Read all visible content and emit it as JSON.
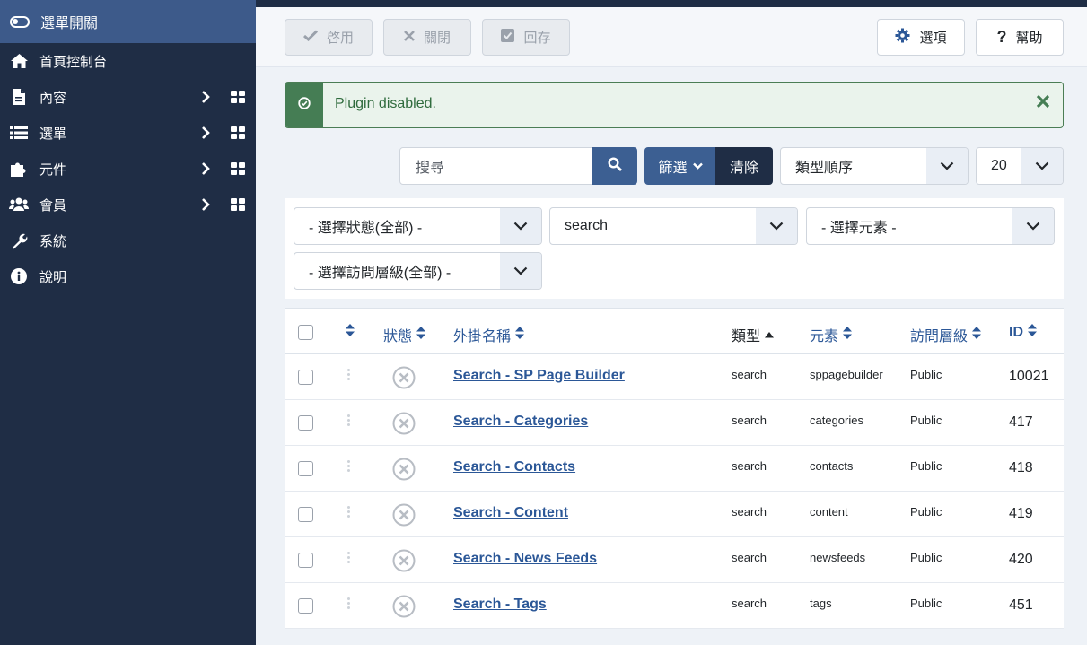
{
  "sidebar": {
    "toggle_label": "選單開關",
    "items": [
      {
        "label": "首頁控制台",
        "icon": "home-icon",
        "expandable": false
      },
      {
        "label": "內容",
        "icon": "file-icon",
        "expandable": true
      },
      {
        "label": "選單",
        "icon": "list-icon",
        "expandable": true
      },
      {
        "label": "元件",
        "icon": "puzzle-icon",
        "expandable": true
      },
      {
        "label": "會員",
        "icon": "users-icon",
        "expandable": true
      },
      {
        "label": "系統",
        "icon": "wrench-icon",
        "expandable": false
      },
      {
        "label": "說明",
        "icon": "info-icon",
        "expandable": false
      }
    ]
  },
  "toolbar": {
    "enable_label": "啓用",
    "disable_label": "關閉",
    "checkin_label": "回存",
    "options_label": "選項",
    "help_label": "幫助"
  },
  "alert": {
    "message": "Plugin disabled."
  },
  "search": {
    "placeholder": "搜尋",
    "filter_label": "篩選",
    "clear_label": "清除",
    "ordering_value": "類型順序",
    "limit_value": "20"
  },
  "filters": {
    "state": "- 選擇狀態(全部) -",
    "folder": "search",
    "element": "- 選擇元素 -",
    "access": "- 選擇訪問層級(全部) -"
  },
  "table": {
    "headers": {
      "status": "狀態",
      "name": "外掛名稱",
      "folder": "類型",
      "element": "元素",
      "access": "訪問層級",
      "id": "ID"
    },
    "rows": [
      {
        "name": "Search - SP Page Builder",
        "folder": "search",
        "element": "sppagebuilder",
        "access": "Public",
        "id": "10021"
      },
      {
        "name": "Search - Categories",
        "folder": "search",
        "element": "categories",
        "access": "Public",
        "id": "417"
      },
      {
        "name": "Search - Contacts",
        "folder": "search",
        "element": "contacts",
        "access": "Public",
        "id": "418"
      },
      {
        "name": "Search - Content",
        "folder": "search",
        "element": "content",
        "access": "Public",
        "id": "419"
      },
      {
        "name": "Search - News Feeds",
        "folder": "search",
        "element": "newsfeeds",
        "access": "Public",
        "id": "420"
      },
      {
        "name": "Search - Tags",
        "folder": "search",
        "element": "tags",
        "access": "Public",
        "id": "451"
      }
    ]
  },
  "colors": {
    "sidebar_bg": "#1f2d45",
    "sidebar_active": "#3d5a8a",
    "primary": "#3c5f92",
    "success": "#457d54",
    "link": "#2b5797"
  }
}
